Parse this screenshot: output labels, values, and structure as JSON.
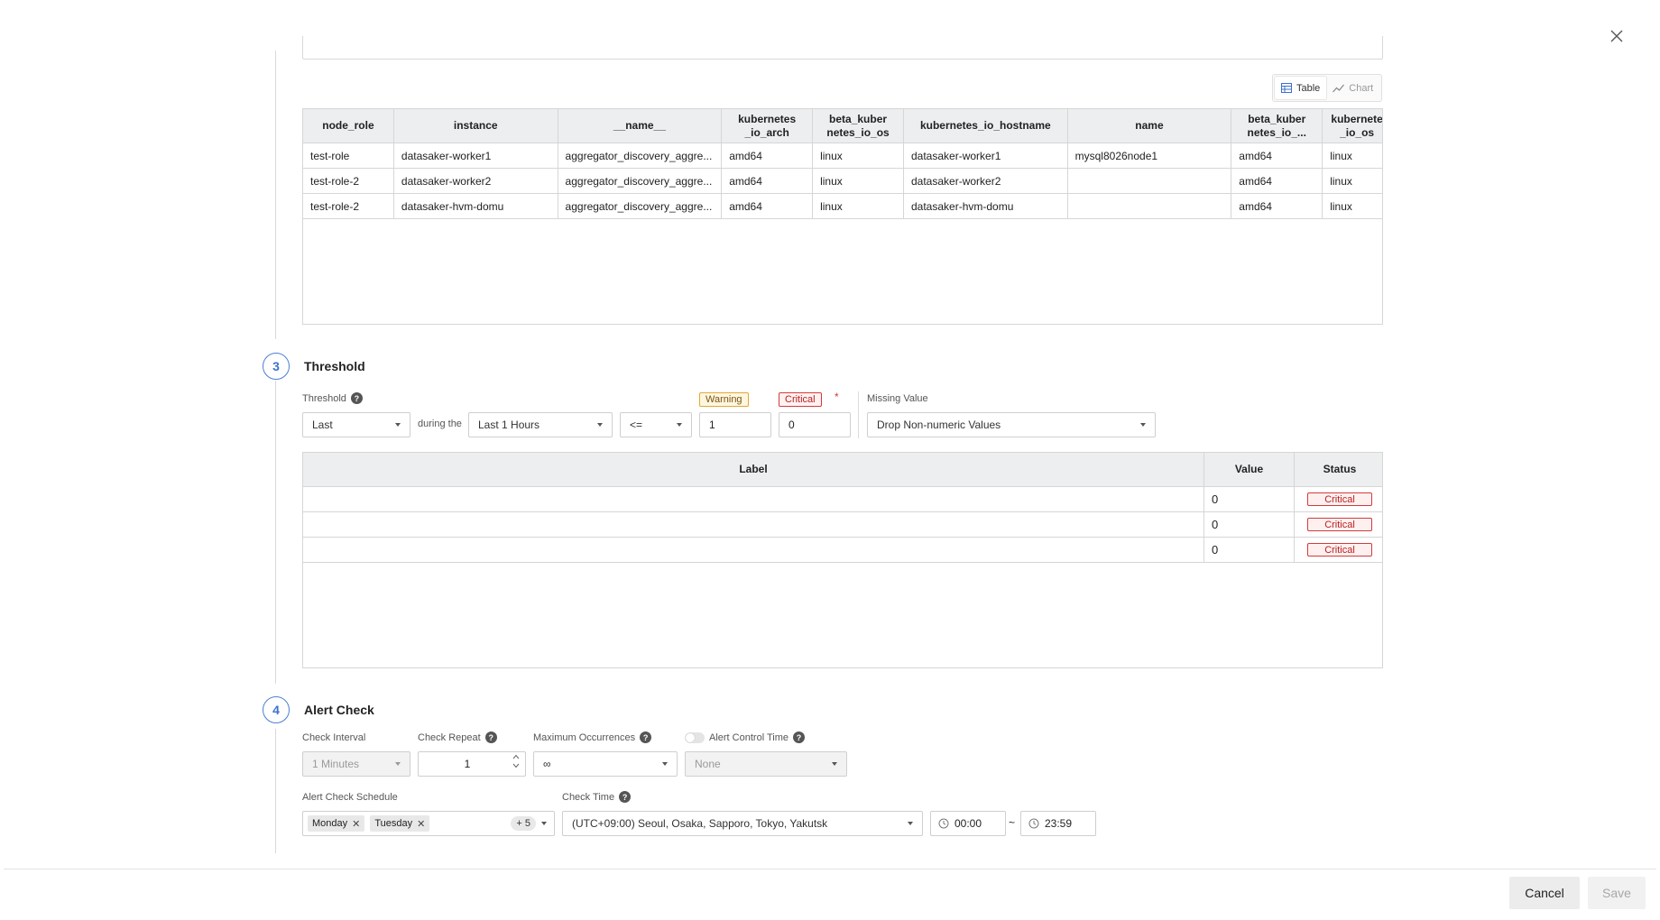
{
  "query_table": {
    "view_toggle": {
      "table_label": "Table",
      "chart_label": "Chart",
      "active": "table"
    },
    "columns": [
      {
        "label": "node_role",
        "width": 100
      },
      {
        "label": "instance",
        "width": 180
      },
      {
        "label": "__name__",
        "width": 180
      },
      {
        "label": "kubernetes_io_arch",
        "width": 100
      },
      {
        "label": "beta_kubernetes_io_os",
        "width": 100
      },
      {
        "label": "kubernetes_io_hostname",
        "width": 180
      },
      {
        "label": "name",
        "width": 180
      },
      {
        "label": "beta_kubernetes_io_...",
        "width": 100
      },
      {
        "label": "kubernetes_io_os",
        "width": 76
      }
    ],
    "header_display": [
      [
        "node_role"
      ],
      [
        "instance"
      ],
      [
        "__name__"
      ],
      [
        "kubernetes",
        "_io_arch"
      ],
      [
        "beta_kuber",
        "netes_io_os"
      ],
      [
        "kubernetes_io_hostname"
      ],
      [
        "name"
      ],
      [
        "beta_kuber",
        "netes_io_..."
      ],
      [
        "kubernete",
        "_io_os"
      ]
    ],
    "rows": [
      [
        "test-role",
        "datasaker-worker1",
        "aggregator_discovery_aggre...",
        "amd64",
        "linux",
        "datasaker-worker1",
        "mysql8026node1",
        "amd64",
        "linux"
      ],
      [
        "test-role-2",
        "datasaker-worker2",
        "aggregator_discovery_aggre...",
        "amd64",
        "linux",
        "datasaker-worker2",
        "",
        "amd64",
        "linux"
      ],
      [
        "test-role-2",
        "datasaker-hvm-domu",
        "aggregator_discovery_aggre...",
        "amd64",
        "linux",
        "datasaker-hvm-domu",
        "",
        "amd64",
        "linux"
      ]
    ]
  },
  "threshold_section": {
    "step_number": "3",
    "title": "Threshold",
    "threshold_label": "Threshold",
    "aggregation_select": "Last",
    "during_text": "during the",
    "period_select": "Last 1 Hours",
    "operator_select": "<=",
    "warning_badge": "Warning",
    "critical_badge": "Critical",
    "required_mark": "*",
    "warning_value": "1",
    "critical_value": "0",
    "missing_value_label": "Missing Value",
    "missing_value_select": "Drop Non-numeric Values",
    "result_table": {
      "headers": {
        "label": "Label",
        "value": "Value",
        "status": "Status"
      },
      "rows": [
        {
          "label": "",
          "value": "0",
          "status": "Critical"
        },
        {
          "label": "",
          "value": "0",
          "status": "Critical"
        },
        {
          "label": "",
          "value": "0",
          "status": "Critical"
        }
      ]
    }
  },
  "alert_check_section": {
    "step_number": "4",
    "title": "Alert Check",
    "check_interval_label": "Check Interval",
    "check_interval_value": "1 Minutes",
    "check_repeat_label": "Check Repeat",
    "check_repeat_value": "1",
    "max_occurrences_label": "Maximum Occurrences",
    "max_occurrences_value": "∞",
    "alert_control_time_label": "Alert Control Time",
    "alert_control_time_value": "None",
    "schedule_label": "Alert Check Schedule",
    "schedule_tags": [
      "Monday",
      "Tuesday"
    ],
    "schedule_more": "+ 5",
    "check_time_label": "Check Time",
    "timezone_value": "(UTC+09:00) Seoul, Osaka, Sapporo, Tokyo, Yakutsk",
    "start_time": "00:00",
    "range_separator": "~",
    "end_time": "23:59"
  },
  "footer": {
    "cancel_label": "Cancel",
    "save_label": "Save"
  },
  "colors": {
    "accent": "#3b72cc",
    "critical": "#d23b3b",
    "warning": "#e2a63a"
  }
}
